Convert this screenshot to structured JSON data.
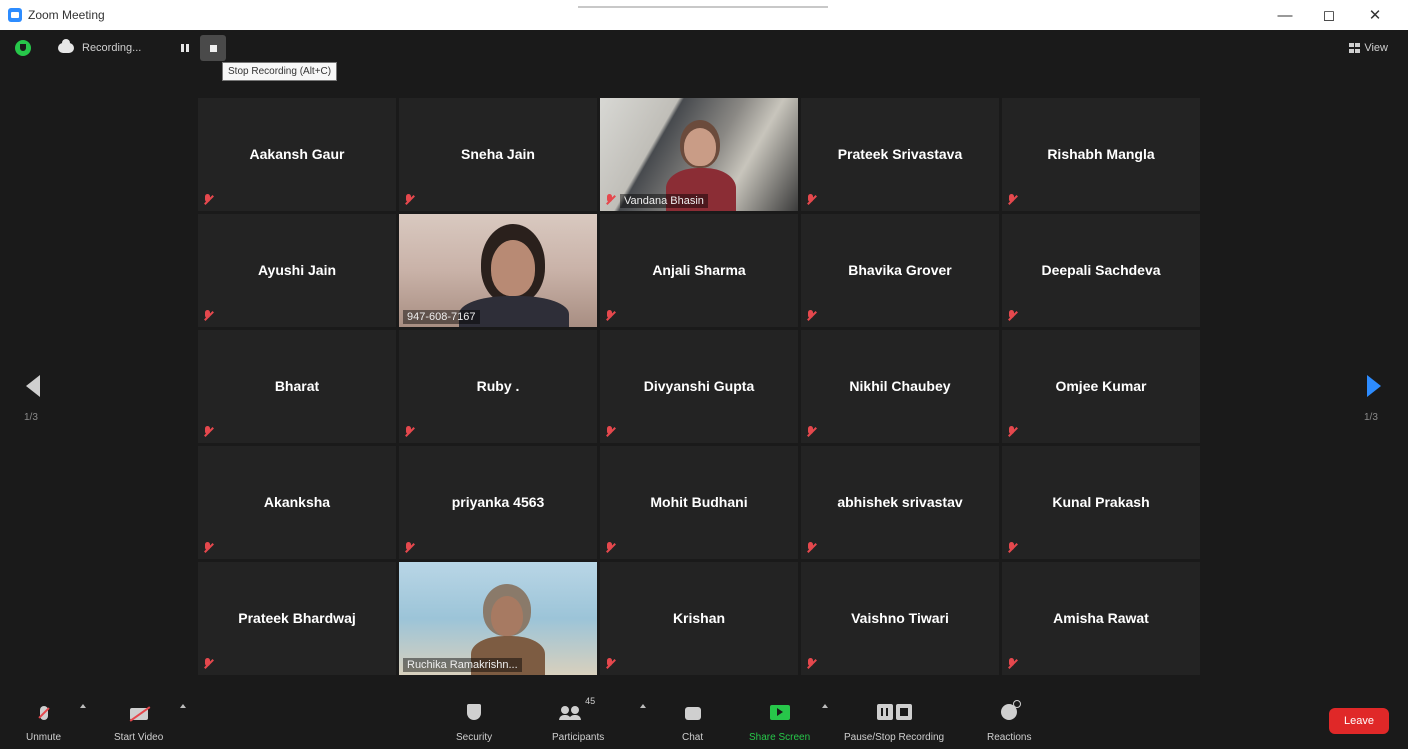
{
  "window": {
    "title": "Zoom Meeting",
    "controls": [
      "—",
      "◻",
      "✕"
    ]
  },
  "topbar": {
    "recording_label": "Recording...",
    "stop_tooltip": "Stop Recording (Alt+C)",
    "view_label": "View"
  },
  "gallery": {
    "tiles": [
      {
        "name": "Aakansh Gaur",
        "video": false,
        "muted": true
      },
      {
        "name": "Sneha Jain",
        "video": false,
        "muted": true
      },
      {
        "name": "Vandana Bhasin",
        "video": true,
        "muted": true
      },
      {
        "name": "Prateek Srivastava",
        "video": false,
        "muted": true
      },
      {
        "name": "Rishabh Mangla",
        "video": false,
        "muted": true
      },
      {
        "name": "Ayushi Jain",
        "video": false,
        "muted": true
      },
      {
        "name": "947-608-7167",
        "video": true,
        "muted": false
      },
      {
        "name": "Anjali Sharma",
        "video": false,
        "muted": true
      },
      {
        "name": "Bhavika Grover",
        "video": false,
        "muted": true
      },
      {
        "name": "Deepali Sachdeva",
        "video": false,
        "muted": true
      },
      {
        "name": "Bharat",
        "video": false,
        "muted": true
      },
      {
        "name": "Ruby .",
        "video": false,
        "muted": true
      },
      {
        "name": "Divyanshi Gupta",
        "video": false,
        "muted": true
      },
      {
        "name": "Nikhil Chaubey",
        "video": false,
        "muted": true
      },
      {
        "name": "Omjee Kumar",
        "video": false,
        "muted": true
      },
      {
        "name": "Akanksha",
        "video": false,
        "muted": true
      },
      {
        "name": "priyanka 4563",
        "video": false,
        "muted": true
      },
      {
        "name": "Mohit Budhani",
        "video": false,
        "muted": true
      },
      {
        "name": "abhishek srivastav",
        "video": false,
        "muted": true
      },
      {
        "name": "Kunal Prakash",
        "video": false,
        "muted": true
      },
      {
        "name": "Prateek Bhardwaj",
        "video": false,
        "muted": true
      },
      {
        "name": "Ruchika Ramakrishn...",
        "video": true,
        "muted": false,
        "active_speaker": true
      },
      {
        "name": "Krishan",
        "video": false,
        "muted": true
      },
      {
        "name": "Vaishno Tiwari",
        "video": false,
        "muted": true
      },
      {
        "name": "Amisha Rawat",
        "video": false,
        "muted": true
      }
    ],
    "prev_page_label": "1/3",
    "next_page_label": "1/3"
  },
  "toolbar": {
    "unmute": "Unmute",
    "start_video": "Start Video",
    "security": "Security",
    "participants": "Participants",
    "participants_count": "45",
    "chat": "Chat",
    "share_screen": "Share Screen",
    "pause_stop_recording": "Pause/Stop Recording",
    "reactions": "Reactions",
    "leave": "Leave"
  },
  "colors": {
    "background": "#1a1a1a",
    "tile": "#232323",
    "accent_blue": "#2d8cff",
    "share_green": "#27c74a",
    "leave_red": "#e02828",
    "active_speaker": "#c9d93a",
    "mute_red": "#e5484d"
  }
}
